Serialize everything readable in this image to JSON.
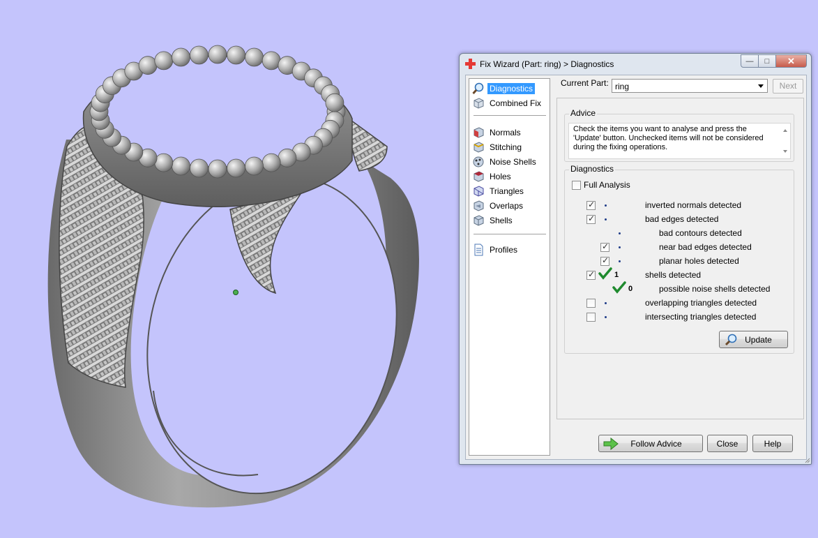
{
  "window": {
    "title": "Fix Wizard (Part: ring) > Diagnostics",
    "minimize": "—",
    "maximize": "□",
    "close": "✕"
  },
  "nav": {
    "items": [
      {
        "label": "Diagnostics",
        "icon": "magnifier-icon",
        "selected": true
      },
      {
        "label": "Combined Fix",
        "icon": "cube-icon"
      },
      {
        "label": "Normals",
        "icon": "normals-cube-icon"
      },
      {
        "label": "Stitching",
        "icon": "stitching-cube-icon"
      },
      {
        "label": "Noise Shells",
        "icon": "noise-shells-icon"
      },
      {
        "label": "Holes",
        "icon": "holes-cube-icon"
      },
      {
        "label": "Triangles",
        "icon": "triangles-cube-icon"
      },
      {
        "label": "Overlaps",
        "icon": "overlaps-cube-icon"
      },
      {
        "label": "Shells",
        "icon": "shells-cube-icon"
      },
      {
        "label": "Profiles",
        "icon": "document-icon"
      }
    ]
  },
  "part": {
    "label": "Current Part:",
    "value": "ring",
    "next": "Next"
  },
  "advice": {
    "title": "Advice",
    "text": "Check the items you want to analyse and press the 'Update' button. Unchecked items will not be considered during the fixing operations."
  },
  "diagnostics": {
    "title": "Diagnostics",
    "full_analysis": {
      "label": "Full Analysis",
      "checked": false
    },
    "rows": [
      {
        "label": "inverted normals detected",
        "checked": true
      },
      {
        "label": "bad edges detected",
        "checked": true
      },
      {
        "label": "bad contours detected"
      },
      {
        "label": "near bad edges detected",
        "checked": true
      },
      {
        "label": "planar holes detected",
        "checked": true
      },
      {
        "label": "shells detected",
        "checked": true,
        "count": "1"
      },
      {
        "label": "possible noise shells detected",
        "count": "0"
      },
      {
        "label": "overlapping triangles detected",
        "checked": false
      },
      {
        "label": "intersecting triangles detected",
        "checked": false
      }
    ],
    "update": "Update"
  },
  "footer": {
    "follow_advice": "Follow Advice",
    "close": "Close",
    "help": "Help"
  },
  "colors": {
    "viewport_bg": "#c4c4fc",
    "selection": "#3399ff",
    "tick_green": "#1f8a2e"
  }
}
